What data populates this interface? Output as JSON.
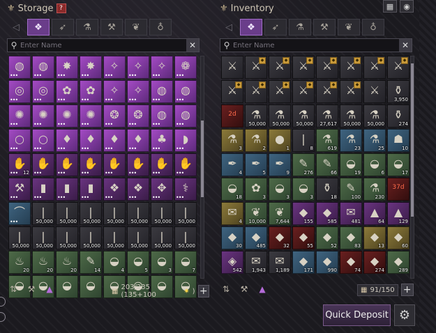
{
  "storage": {
    "title": "Storage",
    "help_icon": "?",
    "tabs": [
      "all-items-icon",
      "weapon-icon",
      "potion-icon",
      "anvil-icon",
      "herb-icon",
      "bag-icon"
    ],
    "search_placeholder": "Enter Name",
    "capacity": "203/235 (135+100",
    "items": [
      {
        "c": "c-p",
        "g": "◍",
        "d": 1
      },
      {
        "c": "c-p",
        "g": "◍",
        "d": 1
      },
      {
        "c": "c-p",
        "g": "✸",
        "d": 1
      },
      {
        "c": "c-p",
        "g": "✸",
        "d": 1
      },
      {
        "c": "c-p",
        "g": "✧",
        "d": 1
      },
      {
        "c": "c-p",
        "g": "✧",
        "d": 1
      },
      {
        "c": "c-p",
        "g": "✧",
        "d": 1
      },
      {
        "c": "c-p",
        "g": "❁",
        "d": 1
      },
      {
        "c": "c-p",
        "g": "◎",
        "d": 1
      },
      {
        "c": "c-p",
        "g": "◎",
        "d": 1
      },
      {
        "c": "c-p",
        "g": "✿",
        "d": 1
      },
      {
        "c": "c-p",
        "g": "✿",
        "d": 1
      },
      {
        "c": "c-p",
        "g": "✧",
        "d": 1
      },
      {
        "c": "c-p",
        "g": "✧",
        "d": 1
      },
      {
        "c": "c-p",
        "g": "◍",
        "d": 1
      },
      {
        "c": "c-p",
        "g": "◍",
        "d": 1
      },
      {
        "c": "c-p",
        "g": "✺",
        "d": 1
      },
      {
        "c": "c-p",
        "g": "✺",
        "d": 1
      },
      {
        "c": "c-p",
        "g": "✺",
        "d": 1
      },
      {
        "c": "c-p",
        "g": "✺",
        "d": 1
      },
      {
        "c": "c-p",
        "g": "❂",
        "d": 1
      },
      {
        "c": "c-p",
        "g": "❂",
        "d": 1
      },
      {
        "c": "c-p",
        "g": "◍",
        "d": 1
      },
      {
        "c": "c-p",
        "g": "◍",
        "d": 1
      },
      {
        "c": "c-p",
        "g": "○",
        "d": 1
      },
      {
        "c": "c-p",
        "g": "○",
        "d": 1
      },
      {
        "c": "c-p",
        "g": "♦",
        "d": 1
      },
      {
        "c": "c-p",
        "g": "♦",
        "d": 1
      },
      {
        "c": "c-p",
        "g": "♦",
        "d": 1
      },
      {
        "c": "c-p",
        "g": "♦",
        "d": 1
      },
      {
        "c": "c-p",
        "g": "♣",
        "d": 1
      },
      {
        "c": "c-p",
        "g": "◗",
        "d": 1
      },
      {
        "c": "c-dp",
        "g": "✋",
        "d": 1,
        "q": "12"
      },
      {
        "c": "c-dp",
        "g": "✋",
        "d": 1
      },
      {
        "c": "c-dp",
        "g": "✋",
        "d": 1
      },
      {
        "c": "c-dp",
        "g": "✋",
        "d": 1
      },
      {
        "c": "c-dp",
        "g": "✋",
        "d": 1
      },
      {
        "c": "c-dp",
        "g": "✋",
        "d": 1
      },
      {
        "c": "c-dp",
        "g": "✋",
        "d": 1
      },
      {
        "c": "c-dp",
        "g": "✋",
        "d": 1
      },
      {
        "c": "c-dp",
        "g": "⚒",
        "d": 1
      },
      {
        "c": "c-dp",
        "g": "▮",
        "d": 1
      },
      {
        "c": "c-dp",
        "g": "▮",
        "d": 1
      },
      {
        "c": "c-dp",
        "g": "▮",
        "d": 1
      },
      {
        "c": "c-dp",
        "g": "❖",
        "d": 1
      },
      {
        "c": "c-dp",
        "g": "❖",
        "d": 1
      },
      {
        "c": "c-dp",
        "g": "✥",
        "d": 1
      },
      {
        "c": "c-dp",
        "g": "⚕",
        "d": 1
      },
      {
        "c": "c-b",
        "g": "⌒",
        "d": 1
      },
      {
        "c": "c-d",
        "g": "❘",
        "q": "50,000"
      },
      {
        "c": "c-d",
        "g": "❘",
        "q": "50,000"
      },
      {
        "c": "c-d",
        "g": "❘",
        "q": "50,000"
      },
      {
        "c": "c-d",
        "g": "❘",
        "q": "50,000"
      },
      {
        "c": "c-d",
        "g": "❘",
        "q": "50,000"
      },
      {
        "c": "c-d",
        "g": "❘",
        "q": "50,000"
      },
      {
        "c": "c-d",
        "g": "❘",
        "q": "50,000"
      },
      {
        "c": "c-d",
        "g": "❘",
        "q": "50,000"
      },
      {
        "c": "c-d",
        "g": "❘",
        "q": "50,000"
      },
      {
        "c": "c-d",
        "g": "❘",
        "q": "50,000"
      },
      {
        "c": "c-d",
        "g": "❘",
        "q": "50,000"
      },
      {
        "c": "c-d",
        "g": "❘",
        "q": "50,000"
      },
      {
        "c": "c-d",
        "g": "❘",
        "q": "50,000"
      },
      {
        "c": "c-d",
        "g": "❘",
        "q": "50,000"
      },
      {
        "c": "c-d",
        "g": "❘",
        "q": "50,000"
      },
      {
        "c": "c-g",
        "g": "♨",
        "q": "20"
      },
      {
        "c": "c-g",
        "g": "♨",
        "q": "20"
      },
      {
        "c": "c-g",
        "g": "♨",
        "q": "20"
      },
      {
        "c": "c-g",
        "g": "✎",
        "q": "14"
      },
      {
        "c": "c-g",
        "g": "◒",
        "q": "4"
      },
      {
        "c": "c-g",
        "g": "◒",
        "q": "5"
      },
      {
        "c": "c-g",
        "g": "◒",
        "q": "3"
      },
      {
        "c": "c-g",
        "g": "◒",
        "q": "7"
      },
      {
        "c": "c-g",
        "g": "◒"
      },
      {
        "c": "c-g",
        "g": "◒"
      },
      {
        "c": "c-g",
        "g": "◒"
      },
      {
        "c": "c-g",
        "g": "◒"
      },
      {
        "c": "c-g",
        "g": "◒"
      },
      {
        "c": "c-g",
        "g": "◒"
      },
      {
        "c": "c-g",
        "g": "◒"
      },
      {
        "c": "c-g",
        "g": "◒"
      }
    ]
  },
  "inventory": {
    "title": "Inventory",
    "tabs": [
      "all-items-icon",
      "weapon-icon",
      "potion-icon",
      "anvil-icon",
      "herb-icon",
      "bag-icon"
    ],
    "search_placeholder": "Enter Name",
    "capacity": "91/150",
    "items": [
      {
        "c": "c-d",
        "g": "⚔"
      },
      {
        "c": "c-d",
        "g": "⚔",
        "b": 1
      },
      {
        "c": "c-d",
        "g": "⚔",
        "b": 1
      },
      {
        "c": "c-d",
        "g": "⚔",
        "b": 1
      },
      {
        "c": "c-d",
        "g": "⚔",
        "b": 1
      },
      {
        "c": "c-d",
        "g": "⚔",
        "b": 1
      },
      {
        "c": "c-d",
        "g": "⚔",
        "b": 1
      },
      {
        "c": "c-d",
        "g": "⚔",
        "b": 1
      },
      {
        "c": "c-d",
        "g": "⚔",
        "b": 1
      },
      {
        "c": "c-d",
        "g": "⚔",
        "b": 1
      },
      {
        "c": "c-d",
        "g": "⚔",
        "b": 1
      },
      {
        "c": "c-d",
        "g": "⚔",
        "b": 1
      },
      {
        "c": "c-d",
        "g": "⚔",
        "b": 1
      },
      {
        "c": "c-d",
        "g": "⚔",
        "b": 1
      },
      {
        "c": "c-d",
        "g": "⚔"
      },
      {
        "c": "c-d",
        "g": "⚱",
        "q": "3,950"
      },
      {
        "c": "c-r",
        "g": "",
        "lbl": "2d"
      },
      {
        "c": "c-d",
        "g": "⚗",
        "q": "50,000"
      },
      {
        "c": "c-d",
        "g": "⚗",
        "q": "50,000"
      },
      {
        "c": "c-d",
        "g": "⚗",
        "q": "50,000"
      },
      {
        "c": "c-d",
        "g": "⚗",
        "q": "27,617"
      },
      {
        "c": "c-d",
        "g": "⚗",
        "q": "50,000"
      },
      {
        "c": "c-d",
        "g": "⚗",
        "q": "50,000"
      },
      {
        "c": "c-d",
        "g": "⚱",
        "q": "274"
      },
      {
        "c": "c-y",
        "g": "⚗",
        "q": "3"
      },
      {
        "c": "c-y",
        "g": "⚗",
        "q": "2"
      },
      {
        "c": "c-y",
        "g": "●",
        "q": "1"
      },
      {
        "c": "c-d",
        "g": "❘",
        "q": "8"
      },
      {
        "c": "c-g",
        "g": "⚗",
        "q": "619"
      },
      {
        "c": "c-b",
        "g": "⚗",
        "q": "23"
      },
      {
        "c": "c-b",
        "g": "⚗",
        "q": "25"
      },
      {
        "c": "c-b",
        "g": "☗",
        "q": "10"
      },
      {
        "c": "c-b",
        "g": "✒",
        "q": "4"
      },
      {
        "c": "c-b",
        "g": "✒",
        "q": "5"
      },
      {
        "c": "c-b",
        "g": "✒",
        "q": "9"
      },
      {
        "c": "c-g",
        "g": "✎",
        "q": "276"
      },
      {
        "c": "c-g",
        "g": "✎",
        "q": "66"
      },
      {
        "c": "c-g",
        "g": "◒",
        "q": "19"
      },
      {
        "c": "c-g",
        "g": "◒",
        "q": "6"
      },
      {
        "c": "c-g",
        "g": "◒",
        "q": "17"
      },
      {
        "c": "c-g",
        "g": "◒",
        "q": "18"
      },
      {
        "c": "c-g",
        "g": "✿",
        "q": "3"
      },
      {
        "c": "c-g",
        "g": "◒",
        "q": "3"
      },
      {
        "c": "c-g",
        "g": "◒",
        "q": "3"
      },
      {
        "c": "c-d",
        "g": "⚱",
        "q": "18"
      },
      {
        "c": "c-g",
        "g": "✎",
        "q": "100"
      },
      {
        "c": "c-g",
        "g": "⚗",
        "q": "230"
      },
      {
        "c": "c-r",
        "g": "",
        "lbl": "37d"
      },
      {
        "c": "c-y",
        "g": "✉",
        "q": "4"
      },
      {
        "c": "c-g",
        "g": "❦",
        "q": "10,000"
      },
      {
        "c": "c-g",
        "g": "❦",
        "q": "7,644"
      },
      {
        "c": "c-dp",
        "g": "◆",
        "q": "155"
      },
      {
        "c": "c-dp",
        "g": "◆",
        "q": "585"
      },
      {
        "c": "c-dp",
        "g": "✉",
        "q": "481"
      },
      {
        "c": "c-dp",
        "g": "▲",
        "q": "64"
      },
      {
        "c": "c-dp",
        "g": "▲",
        "q": "129"
      },
      {
        "c": "c-b",
        "g": "◆",
        "q": "30"
      },
      {
        "c": "c-b",
        "g": "◆",
        "q": "485"
      },
      {
        "c": "c-r",
        "g": "◆",
        "q": "32"
      },
      {
        "c": "c-r",
        "g": "◆",
        "q": "55"
      },
      {
        "c": "c-g",
        "g": "◆",
        "q": "52"
      },
      {
        "c": "c-g",
        "g": "◆",
        "q": "83"
      },
      {
        "c": "c-y",
        "g": "◆",
        "q": "13"
      },
      {
        "c": "c-y",
        "g": "◆",
        "q": "60"
      },
      {
        "c": "c-dp",
        "g": "◈",
        "q": "542"
      },
      {
        "c": "c-d",
        "g": "✉",
        "q": "1,943"
      },
      {
        "c": "c-d",
        "g": "✉",
        "q": "1,189"
      },
      {
        "c": "c-b",
        "g": "◆",
        "q": "171"
      },
      {
        "c": "c-b",
        "g": "◆",
        "q": "990"
      },
      {
        "c": "c-r",
        "g": "◆",
        "q": "74"
      },
      {
        "c": "c-r",
        "g": "◆",
        "q": "274"
      },
      {
        "c": "c-g",
        "g": "◆",
        "q": "289"
      }
    ]
  },
  "quick_deposit_label": "Quick Deposit"
}
